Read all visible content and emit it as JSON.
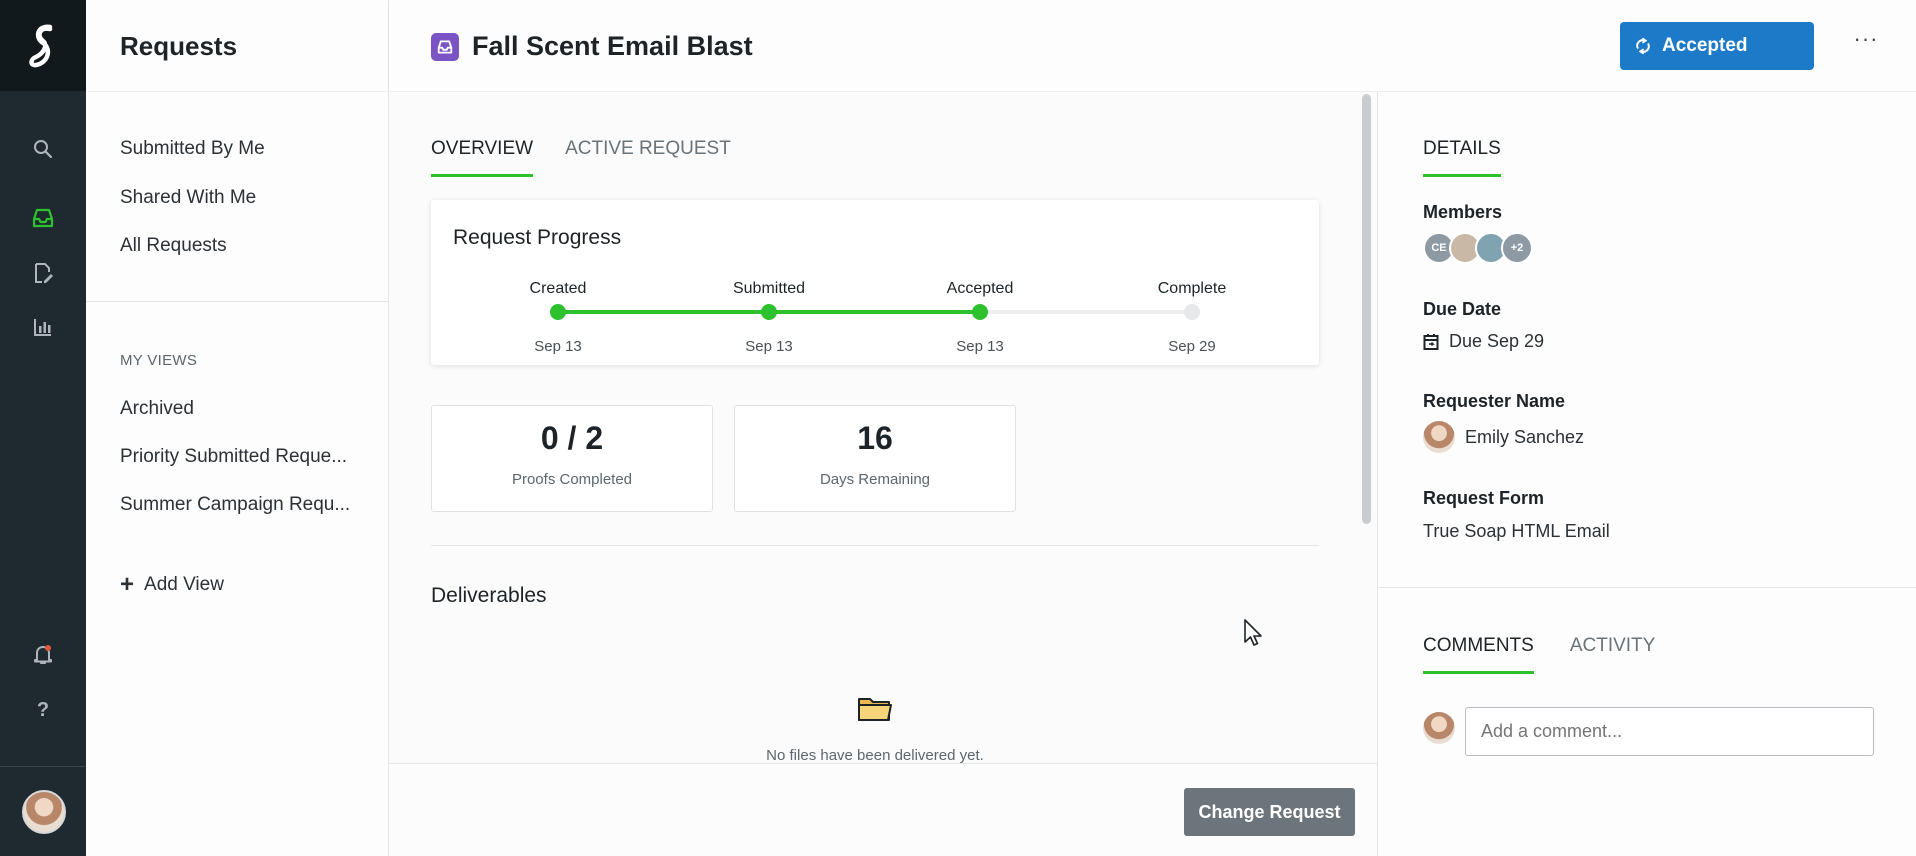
{
  "rail": {
    "icons": [
      "logo-icon",
      "search-icon",
      "inbox-icon",
      "edit-document-icon",
      "chart-icon",
      "bell-icon",
      "help-icon"
    ],
    "help_glyph": "?"
  },
  "nav": {
    "title": "Requests",
    "items": [
      "Submitted By Me",
      "Shared With Me",
      "All Requests"
    ],
    "section_label": "MY VIEWS",
    "views": [
      "Archived",
      "Priority Submitted Reque...",
      "Summer Campaign Requ..."
    ],
    "add_view": "Add View",
    "add_glyph": "+"
  },
  "header": {
    "request_title": "Fall Scent Email Blast",
    "status_button": "Accepted",
    "more_glyph": "···"
  },
  "main": {
    "tabs": [
      "OVERVIEW",
      "ACTIVE REQUEST"
    ],
    "active_tab": "OVERVIEW",
    "progress": {
      "title": "Request Progress",
      "steps": [
        {
          "label": "Created",
          "date": "Sep 13",
          "done": true
        },
        {
          "label": "Submitted",
          "date": "Sep 13",
          "done": true
        },
        {
          "label": "Accepted",
          "date": "Sep 13",
          "done": true
        },
        {
          "label": "Complete",
          "date": "Sep 29",
          "done": false
        }
      ],
      "fraction_complete": 0.667
    },
    "stats": [
      {
        "value": "0 / 2",
        "label": "Proofs Completed"
      },
      {
        "value": "16",
        "label": "Days Remaining"
      }
    ],
    "deliverables_title": "Deliverables",
    "empty_message": "No files have been delivered yet.",
    "change_button": "Change Request"
  },
  "details": {
    "tab": "DETAILS",
    "members_label": "Members",
    "members": [
      {
        "initials": "CE",
        "color": "#8e9aa3"
      },
      {
        "initials": "",
        "color": "#c9b8a6"
      },
      {
        "initials": "",
        "color": "#7fa3b0"
      },
      {
        "initials": "+2",
        "color": "#8e9aa3"
      }
    ],
    "due_label": "Due Date",
    "due_value": "Due Sep 29",
    "requester_label": "Requester Name",
    "requester_value": "Emily Sanchez",
    "form_label": "Request Form",
    "form_value": "True Soap HTML Email",
    "comment_tabs": [
      "COMMENTS",
      "ACTIVITY"
    ],
    "comment_placeholder": "Add a comment..."
  },
  "colors": {
    "accent_green": "#2dc22d",
    "primary_blue": "#1d7ac9",
    "rail_dark": "#1f2a30",
    "purple_icon": "#7a54c4"
  }
}
